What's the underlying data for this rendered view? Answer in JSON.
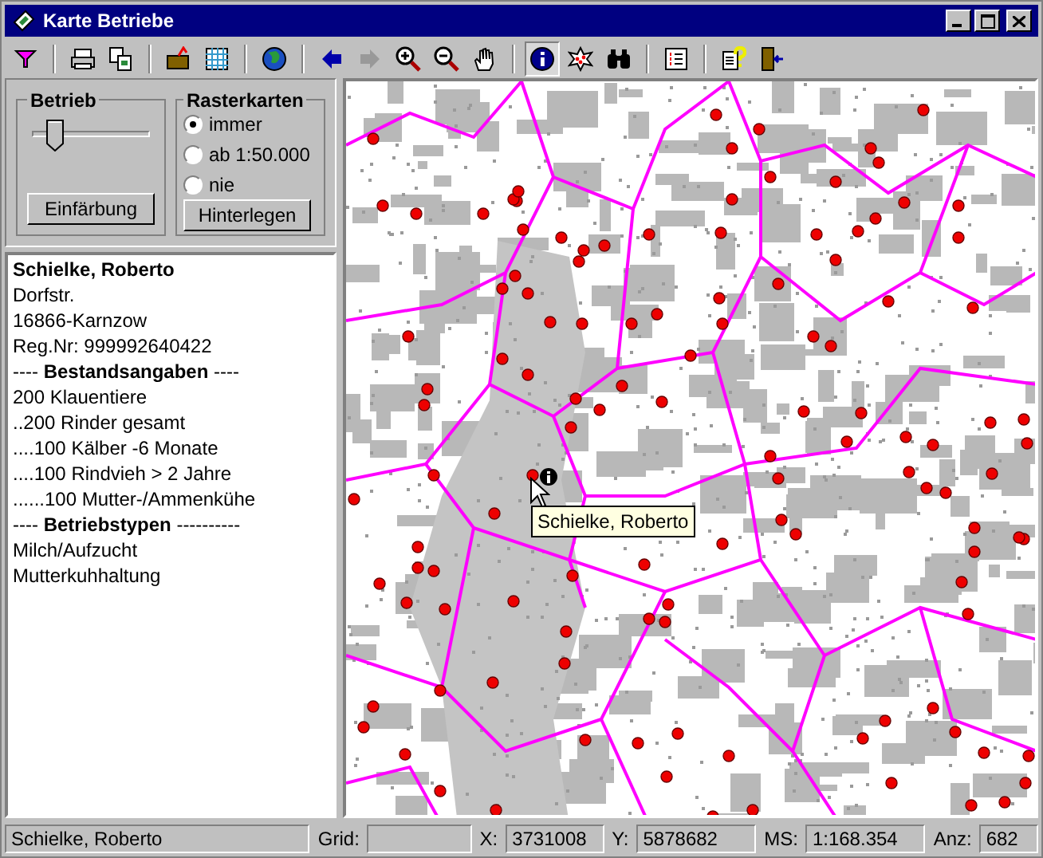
{
  "window": {
    "title": "Karte Betriebe"
  },
  "toolbar": [
    {
      "kind": "filter",
      "pressed": false
    },
    {
      "kind": "separator"
    },
    {
      "kind": "print",
      "pressed": false
    },
    {
      "kind": "copy",
      "pressed": false
    },
    {
      "kind": "separator"
    },
    {
      "kind": "open",
      "pressed": false
    },
    {
      "kind": "grid",
      "pressed": false
    },
    {
      "kind": "separator"
    },
    {
      "kind": "globe",
      "pressed": false
    },
    {
      "kind": "separator"
    },
    {
      "kind": "back",
      "pressed": false
    },
    {
      "kind": "forward",
      "pressed": false,
      "disabled": true
    },
    {
      "kind": "zoom-in",
      "pressed": false
    },
    {
      "kind": "zoom-out",
      "pressed": false
    },
    {
      "kind": "hand",
      "pressed": false
    },
    {
      "kind": "separator"
    },
    {
      "kind": "info",
      "pressed": true
    },
    {
      "kind": "select",
      "pressed": false
    },
    {
      "kind": "find",
      "pressed": false
    },
    {
      "kind": "separator"
    },
    {
      "kind": "list",
      "pressed": false
    },
    {
      "kind": "separator"
    },
    {
      "kind": "help",
      "pressed": false
    },
    {
      "kind": "exit",
      "pressed": false
    }
  ],
  "betrieb": {
    "title": "Betrieb",
    "slider": {
      "level": 0.15
    },
    "button": "Einfärbung"
  },
  "rasterkarten": {
    "title": "Rasterkarten",
    "options": [
      {
        "label": "immer",
        "selected": true
      },
      {
        "label": "ab 1:50.000",
        "selected": false
      },
      {
        "label": "nie",
        "selected": false
      }
    ],
    "button": "Hinterlegen"
  },
  "details": [
    {
      "kind": "heading",
      "text": "Schielke, Roberto"
    },
    {
      "kind": "text",
      "text": "Dorfstr."
    },
    {
      "kind": "text",
      "text": "16866-Karnzow"
    },
    {
      "kind": "text",
      "text": "Reg.Nr: 999992640422"
    },
    {
      "kind": "text",
      "text": "---- **Bestandsangaben** ----"
    },
    {
      "kind": "text",
      "text": "200 Klauentiere"
    },
    {
      "kind": "text",
      "text": "..200 Rinder gesamt"
    },
    {
      "kind": "text",
      "text": "....100 Kälber -6 Monate"
    },
    {
      "kind": "text",
      "text": "....100 Rindvieh > 2 Jahre"
    },
    {
      "kind": "text",
      "text": "......100 Mutter-/Ammenkühe"
    },
    {
      "kind": "text",
      "text": "---- **Betriebstypen** ----------"
    },
    {
      "kind": "text",
      "text": "Milch/Aufzucht"
    },
    {
      "kind": "text",
      "text": "Mutterkuhhaltung"
    }
  ],
  "map": {
    "tooltip": "Schielke, Roberto"
  },
  "status_bar": [
    {
      "value": "Schielke, Roberto"
    },
    {
      "label": "Grid:"
    },
    {
      "label": "X:",
      "value": "3731008"
    },
    {
      "label": "Y:",
      "value": "5878682"
    },
    {
      "label": "MS:",
      "value": "1:168.354"
    },
    {
      "label": "Anz:",
      "value": "682"
    }
  ]
}
